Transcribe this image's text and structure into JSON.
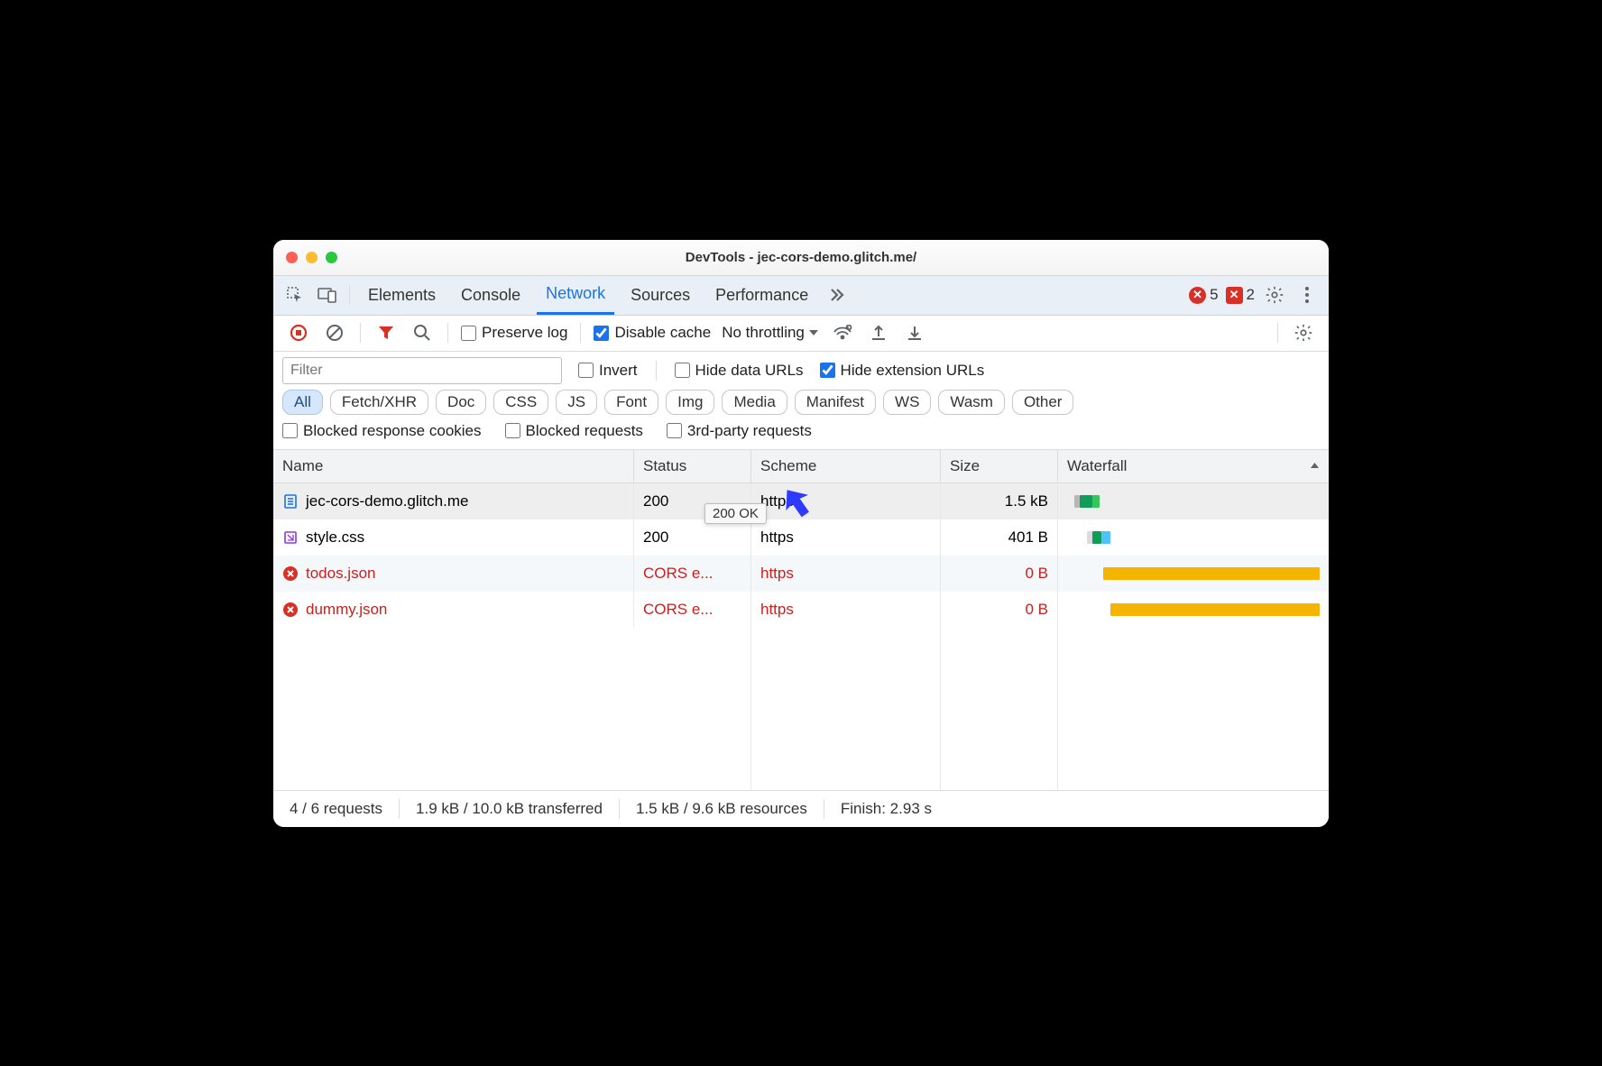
{
  "window": {
    "title": "DevTools - jec-cors-demo.glitch.me/"
  },
  "tabs": {
    "items": [
      "Elements",
      "Console",
      "Network",
      "Sources",
      "Performance"
    ],
    "active": "Network",
    "more_icon": "chevrons-right",
    "error_count": "5",
    "warn_count": "2"
  },
  "toolbar": {
    "preserve_log": "Preserve log",
    "disable_cache": "Disable cache",
    "throttling": "No throttling"
  },
  "filter": {
    "placeholder": "Filter",
    "invert": "Invert",
    "hide_data": "Hide data URLs",
    "hide_ext": "Hide extension URLs"
  },
  "chips": [
    "All",
    "Fetch/XHR",
    "Doc",
    "CSS",
    "JS",
    "Font",
    "Img",
    "Media",
    "Manifest",
    "WS",
    "Wasm",
    "Other"
  ],
  "chips_active": "All",
  "checks": {
    "blocked_cookies": "Blocked response cookies",
    "blocked_req": "Blocked requests",
    "third_party": "3rd-party requests"
  },
  "columns": {
    "name": "Name",
    "status": "Status",
    "scheme": "Scheme",
    "size": "Size",
    "waterfall": "Waterfall"
  },
  "rows": [
    {
      "icon": "doc",
      "name": "jec-cors-demo.glitch.me",
      "status": "200",
      "scheme": "https",
      "size": "1.5 kB",
      "error": false
    },
    {
      "icon": "css",
      "name": "style.css",
      "status": "200",
      "scheme": "https",
      "size": "401 B",
      "error": false
    },
    {
      "icon": "err",
      "name": "todos.json",
      "status": "CORS e...",
      "scheme": "https",
      "size": "0 B",
      "error": true
    },
    {
      "icon": "err",
      "name": "dummy.json",
      "status": "CORS e...",
      "scheme": "https",
      "size": "0 B",
      "error": true
    }
  ],
  "tooltip": {
    "text": "200 OK"
  },
  "status": {
    "requests": "4 / 6 requests",
    "transferred": "1.9 kB / 10.0 kB transferred",
    "resources": "1.5 kB / 9.6 kB resources",
    "finish": "Finish: 2.93 s"
  }
}
